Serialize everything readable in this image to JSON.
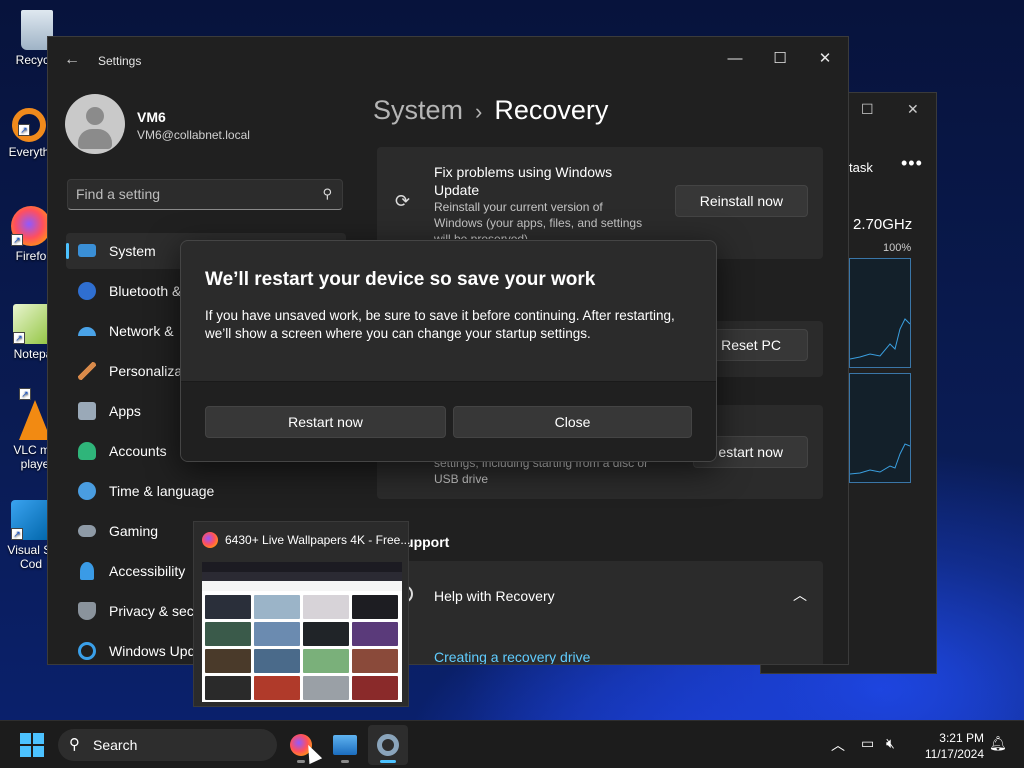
{
  "desktop": {
    "icons": [
      {
        "label": "Recycle"
      },
      {
        "label": "Everyth"
      },
      {
        "label": "Firefo"
      },
      {
        "label": "Notepa"
      },
      {
        "label": "VLC me\nplaye"
      },
      {
        "label": "Visual St\nCod"
      }
    ]
  },
  "task_manager": {
    "task_label": "task",
    "more_label": "•••",
    "cpu_speed": "2.70GHz",
    "cpu_percent": "100%"
  },
  "settings": {
    "app_title": "Settings",
    "user": {
      "name": "VM6",
      "email": "VM6@collabnet.local"
    },
    "search_placeholder": "Find a setting",
    "nav": [
      {
        "label": "System"
      },
      {
        "label": "Bluetooth &"
      },
      {
        "label": "Network &"
      },
      {
        "label": "Personalizat"
      },
      {
        "label": "Apps"
      },
      {
        "label": "Accounts"
      },
      {
        "label": "Time & language"
      },
      {
        "label": "Gaming"
      },
      {
        "label": "Accessibility"
      },
      {
        "label": "Privacy & secu"
      },
      {
        "label": "Windows Upd"
      }
    ],
    "breadcrumb": {
      "parent": "System",
      "separator": "›",
      "current": "Recovery"
    },
    "cards": {
      "fix": {
        "title": "Fix problems using Windows Update",
        "desc": "Reinstall your current version of Windows (your apps, files, and settings will be preserved)",
        "button": "Reinstall now"
      },
      "reset": {
        "button": "Reset PC"
      },
      "advanced": {
        "desc": "settings, including starting from a disc or USB drive",
        "button": "estart now"
      }
    },
    "section_related": "ed support",
    "help": {
      "title": "Help with Recovery",
      "link": "Creating a recovery drive"
    }
  },
  "dialog": {
    "title": "We’ll restart your device so save your work",
    "body": "If you have unsaved work, be sure to save it before continuing. After restarting, we’ll show a screen where you can change your startup settings.",
    "primary_button": "Restart now",
    "secondary_button": "Close"
  },
  "thumbnail": {
    "title": "6430+ Live Wallpapers 4K - Free..."
  },
  "taskbar": {
    "search_label": "Search",
    "time": "3:21 PM",
    "date": "11/17/2024"
  },
  "colors": {
    "accent": "#4cc2ff",
    "link": "#60cdff"
  }
}
